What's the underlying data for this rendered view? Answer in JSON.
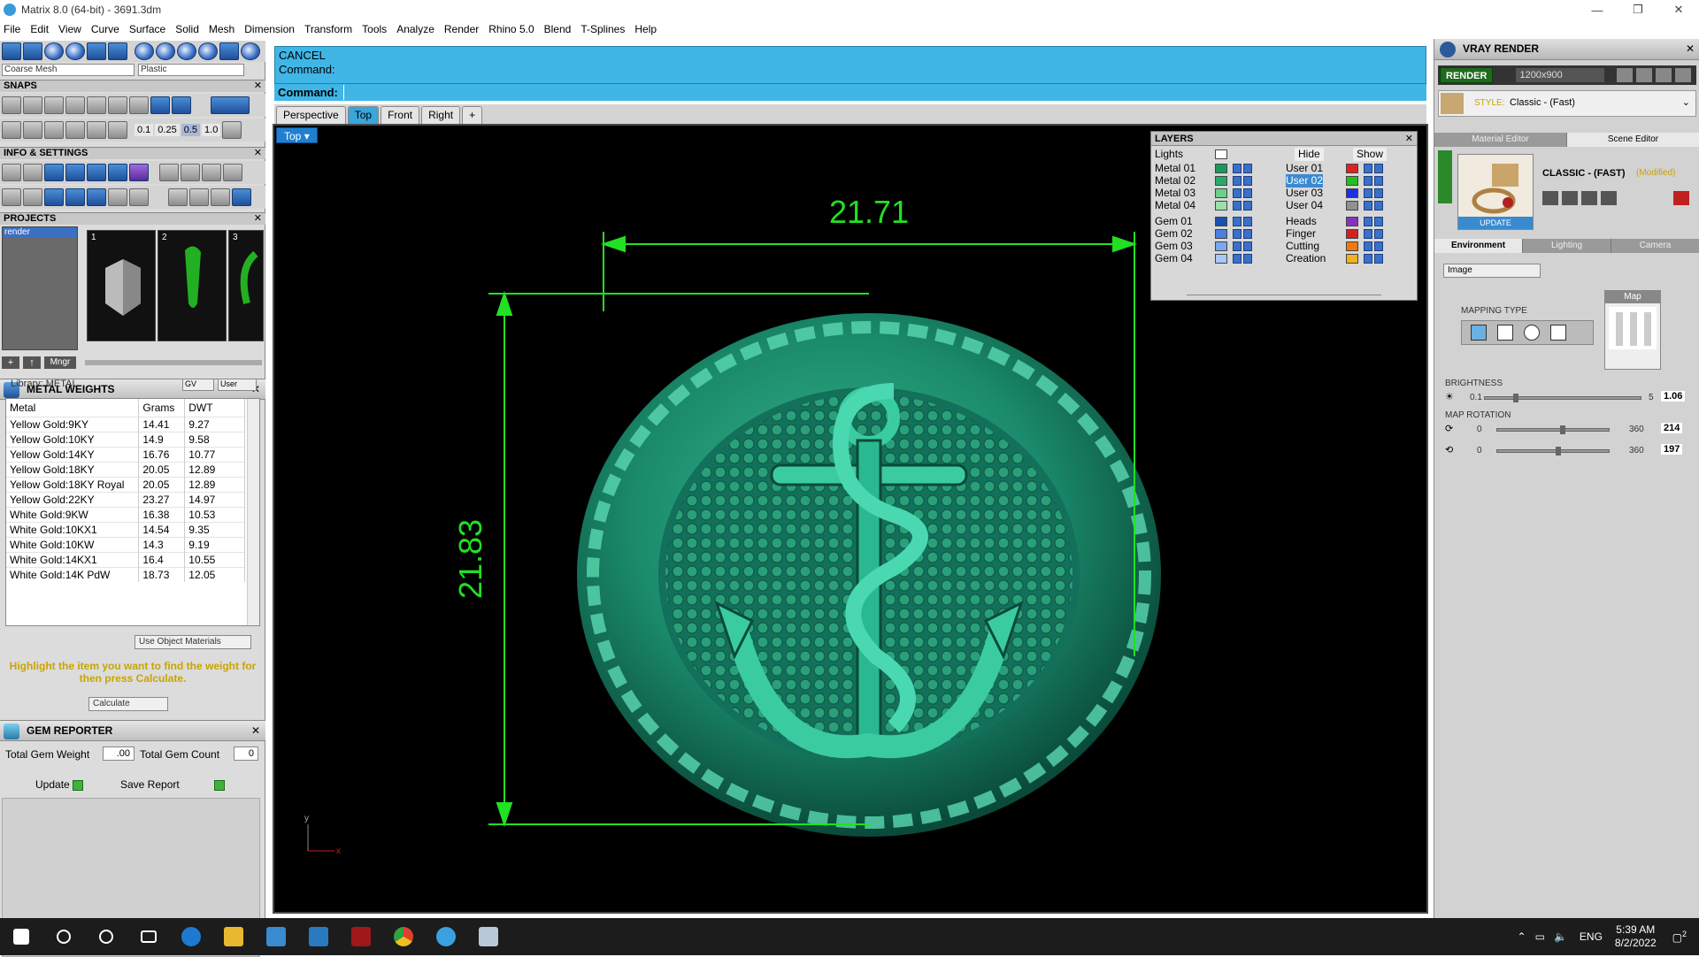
{
  "window": {
    "title": "Matrix 8.0 (64-bit) - 3691.3dm",
    "min": "—",
    "restore": "❐",
    "close": "✕"
  },
  "menu": [
    "File",
    "Edit",
    "View",
    "Curve",
    "Surface",
    "Solid",
    "Mesh",
    "Dimension",
    "Transform",
    "Tools",
    "Analyze",
    "Render",
    "Rhino 5.0",
    "Blend",
    "T-Splines",
    "Help"
  ],
  "toolbar": {
    "mesh_select": "Coarse Mesh",
    "material_select": "Plastic",
    "snap_values": [
      "0.1",
      "0.25",
      "0.5",
      "1.0"
    ]
  },
  "sections": {
    "snaps": "SNAPS",
    "info": "INFO & SETTINGS",
    "projects": "PROJECTS"
  },
  "projects": {
    "items": [
      "render"
    ],
    "slots": [
      "1",
      "2",
      "3"
    ],
    "mngr": "Mngr"
  },
  "metal_weights": {
    "title": "METAL WEIGHTS",
    "library": "Library: METAL",
    "gv": "GV",
    "user": "User",
    "columns": [
      "Metal",
      "Grams",
      "DWT"
    ],
    "rows": [
      [
        "Yellow Gold:9KY",
        "14.41",
        "9.27"
      ],
      [
        "Yellow Gold:10KY",
        "14.9",
        "9.58"
      ],
      [
        "Yellow Gold:14KY",
        "16.76",
        "10.77"
      ],
      [
        "Yellow Gold:18KY",
        "20.05",
        "12.89"
      ],
      [
        "Yellow Gold:18KY Royal",
        "20.05",
        "12.89"
      ],
      [
        "Yellow Gold:22KY",
        "23.27",
        "14.97"
      ],
      [
        "White Gold:9KW",
        "16.38",
        "10.53"
      ],
      [
        "White Gold:10KX1",
        "14.54",
        "9.35"
      ],
      [
        "White Gold:10KW",
        "14.3",
        "9.19"
      ],
      [
        "White Gold:14KX1",
        "16.4",
        "10.55"
      ],
      [
        "White Gold:14K PdW",
        "18.73",
        "12.05"
      ]
    ],
    "use_object_materials": "Use Object Materials",
    "hint": "Highlight the item you want to find the weight for then press Calculate.",
    "calculate": "Calculate"
  },
  "gem_reporter": {
    "title": "GEM REPORTER",
    "total_weight_label": "Total Gem Weight",
    "total_weight_value": ".00",
    "total_count_label": "Total Gem Count",
    "total_count_value": "0",
    "update": "Update",
    "save_report": "Save Report"
  },
  "command": {
    "cancel": "CANCEL",
    "history": "Command:",
    "prompt": "Command:"
  },
  "viewport": {
    "tabs": [
      "Perspective",
      "Top",
      "Front",
      "Right"
    ],
    "active_tab": "Top",
    "label": "Top",
    "dim_width": "21.71",
    "dim_height": "21.83",
    "axis_y": "y",
    "axis_x": "x",
    "model_color": "#1a8a6a"
  },
  "layers": {
    "title": "LAYERS",
    "lights": "Lights",
    "hide": "Hide",
    "show": "Show",
    "left": [
      {
        "name": "Metal 01",
        "color": "#1a9a5a"
      },
      {
        "name": "Metal 02",
        "color": "#2aaa6a"
      },
      {
        "name": "Metal 03",
        "color": "#6ad08a"
      },
      {
        "name": "Metal 04",
        "color": "#9ae0aa"
      },
      {
        "name": "Gem 01",
        "color": "#1a50b0"
      },
      {
        "name": "Gem 02",
        "color": "#4a80e0"
      },
      {
        "name": "Gem 03",
        "color": "#7aa8f0"
      },
      {
        "name": "Gem 04",
        "color": "#a8c8f8"
      }
    ],
    "right": [
      {
        "name": "User 01",
        "color": "#e02020"
      },
      {
        "name": "User 02",
        "color": "#20c020"
      },
      {
        "name": "User 03",
        "color": "#2030e0"
      },
      {
        "name": "User 04",
        "color": "#909090"
      },
      {
        "name": "Heads",
        "color": "#8a30c0"
      },
      {
        "name": "Finger",
        "color": "#d02020"
      },
      {
        "name": "Cutting",
        "color": "#f07a10"
      },
      {
        "name": "Creation",
        "color": "#f0b020"
      }
    ]
  },
  "vray": {
    "title": "VRAY RENDER",
    "render": "RENDER",
    "resolution": "1200x900",
    "style_label": "STYLE:",
    "style_value": "Classic - (Fast)",
    "tabs": [
      "Material Editor",
      "Scene Editor"
    ],
    "active_tab": "Scene Editor",
    "scene_name": "CLASSIC - (FAST)",
    "scene_modified": "(Modified)",
    "update": "UPDATE",
    "env_tabs": [
      "Environment",
      "Lighting",
      "Camera"
    ],
    "active_env_tab": "Environment",
    "env_type": "Image",
    "mapping_type": "MAPPING TYPE",
    "map": "Map",
    "brightness": {
      "label": "BRIGHTNESS",
      "min": "0.1",
      "max": "5",
      "value": "1.06",
      "level": 0.19
    },
    "map_rotation": {
      "label": "MAP ROTATION",
      "min": "0",
      "max": "360",
      "value1": "214",
      "value2": "197",
      "level1": 0.594,
      "level2": 0.547
    }
  },
  "taskbar": {
    "lang": "ENG",
    "time": "5:39 AM",
    "date": "8/2/2022",
    "notif": "2"
  }
}
